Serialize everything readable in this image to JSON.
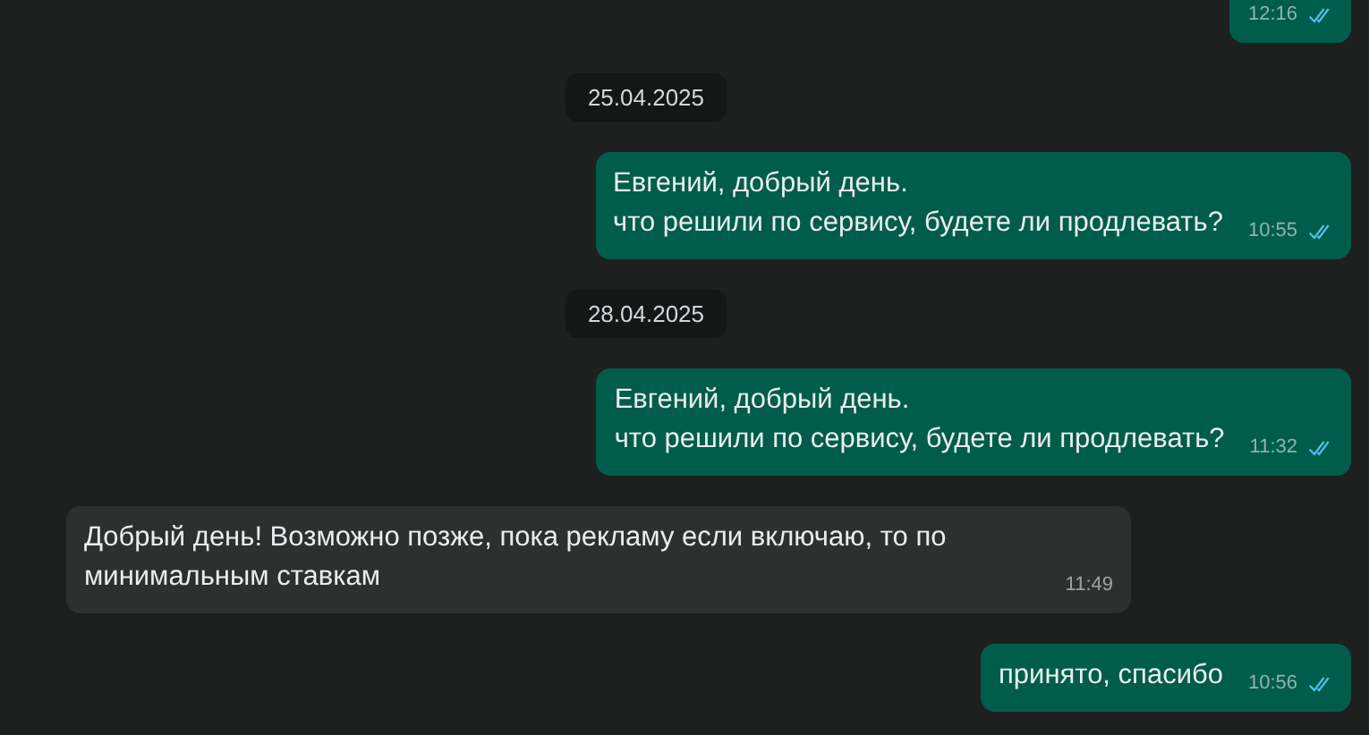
{
  "messages": [
    {
      "kind": "out",
      "time": "12:16",
      "read": true
    },
    {
      "kind": "date",
      "text": "25.04.2025"
    },
    {
      "kind": "out",
      "text": "Евгений, добрый день.\nчто решили по сервису, будете ли продлевать?",
      "time": "10:55",
      "read": true
    },
    {
      "kind": "date",
      "text": "28.04.2025"
    },
    {
      "kind": "out",
      "text": "Евгений, добрый день.\nчто решили по сервису, будете ли продлевать?",
      "time": "11:32",
      "read": true
    },
    {
      "kind": "in",
      "text": "Добрый день! Возможно позже, пока рекламу если включаю, то по минимальным ставкам",
      "time": "11:49"
    },
    {
      "kind": "out",
      "text": "принято, спасибо",
      "time": "10:56",
      "read": true
    }
  ]
}
